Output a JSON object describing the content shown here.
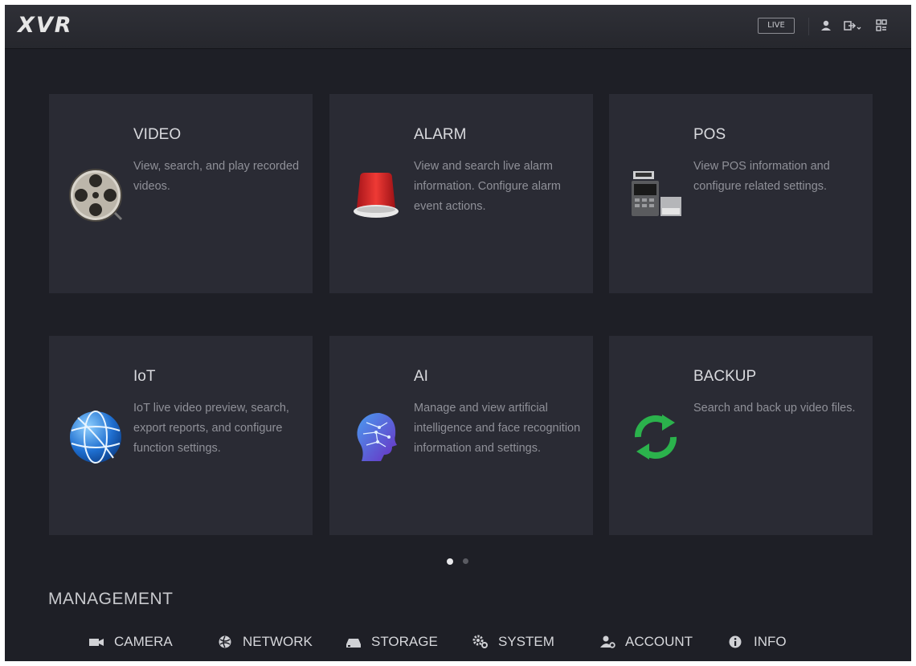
{
  "header": {
    "logo": "XVR",
    "live_label": "LIVE"
  },
  "modules": [
    {
      "title": "VIDEO",
      "desc": "View, search, and play recorded videos.",
      "icon": "film-reel-icon"
    },
    {
      "title": "ALARM",
      "desc": "View and search live alarm information. Configure alarm event actions.",
      "icon": "alarm-beacon-icon"
    },
    {
      "title": "POS",
      "desc": "View POS information and configure related settings.",
      "icon": "pos-terminal-icon"
    },
    {
      "title": "IoT",
      "desc": "IoT live video preview, search, export reports, and configure function settings.",
      "icon": "globe-icon"
    },
    {
      "title": "AI",
      "desc": "Manage and view artificial intelligence and face recognition information and settings.",
      "icon": "ai-head-icon"
    },
    {
      "title": "BACKUP",
      "desc": "Search and back up video files.",
      "icon": "backup-sync-icon"
    }
  ],
  "pagination": {
    "current": 1,
    "total": 2
  },
  "management": {
    "title": "MANAGEMENT",
    "items": [
      {
        "label": "CAMERA",
        "icon": "camera-icon"
      },
      {
        "label": "NETWORK",
        "icon": "network-icon"
      },
      {
        "label": "STORAGE",
        "icon": "storage-icon"
      },
      {
        "label": "SYSTEM",
        "icon": "system-gears-icon"
      },
      {
        "label": "ACCOUNT",
        "icon": "account-icon"
      },
      {
        "label": "INFO",
        "icon": "info-icon"
      }
    ]
  },
  "colors": {
    "background": "#1e1f26",
    "card": "#2a2b34",
    "alarm_red": "#d8262a",
    "backup_green": "#2bb24c",
    "globe_blue": "#1f6fd0"
  }
}
